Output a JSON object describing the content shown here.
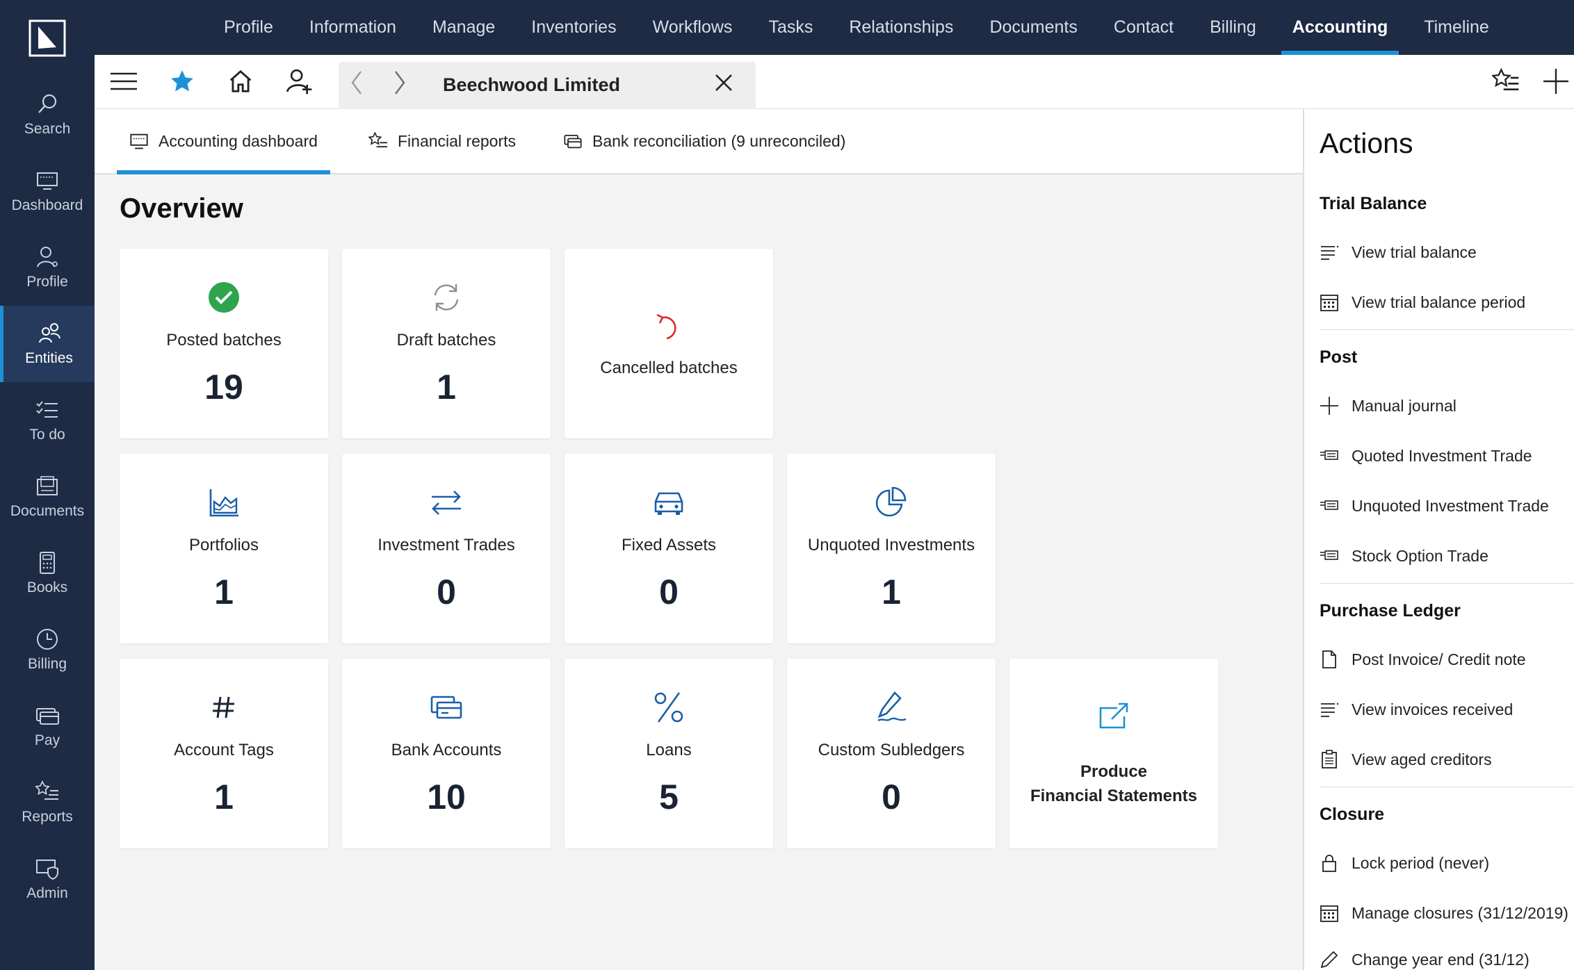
{
  "rail": {
    "items": [
      {
        "label": "Search",
        "icon": "search-icon"
      },
      {
        "label": "Dashboard",
        "icon": "dashboard-icon"
      },
      {
        "label": "Profile",
        "icon": "profile-icon"
      },
      {
        "label": "Entities",
        "icon": "entities-icon",
        "active": true
      },
      {
        "label": "To do",
        "icon": "todo-icon"
      },
      {
        "label": "Documents",
        "icon": "documents-icon"
      },
      {
        "label": "Books",
        "icon": "calculator-icon"
      },
      {
        "label": "Billing",
        "icon": "clock-icon"
      },
      {
        "label": "Pay",
        "icon": "payment-icon"
      },
      {
        "label": "Reports",
        "icon": "reports-icon"
      },
      {
        "label": "Admin",
        "icon": "admin-icon"
      }
    ]
  },
  "topnav": {
    "items": [
      "Profile",
      "Information",
      "Manage",
      "Inventories",
      "Workflows",
      "Tasks",
      "Relationships",
      "Documents",
      "Contact",
      "Billing",
      "Accounting",
      "Timeline"
    ],
    "active": "Accounting"
  },
  "record": {
    "title": "Beechwood Limited"
  },
  "subtabs": [
    {
      "label": "Accounting dashboard",
      "icon": "monitor-icon",
      "active": true
    },
    {
      "label": "Financial reports",
      "icon": "star-list-icon"
    },
    {
      "label": "Bank reconciliation (9 unreconciled)",
      "icon": "bank-card-icon"
    }
  ],
  "overview": {
    "title": "Overview"
  },
  "cards": [
    {
      "label": "Posted batches",
      "value": "19",
      "icon": "check-circle-icon"
    },
    {
      "label": "Draft batches",
      "value": "1",
      "icon": "refresh-icon"
    },
    {
      "label": "Cancelled batches",
      "value": "",
      "icon": "undo-icon"
    },
    {
      "label": "Portfolios",
      "value": "1",
      "icon": "area-chart-icon"
    },
    {
      "label": "Investment Trades",
      "value": "0",
      "icon": "transfer-arrows-icon"
    },
    {
      "label": "Fixed Assets",
      "value": "0",
      "icon": "car-icon"
    },
    {
      "label": "Unquoted Investments",
      "value": "1",
      "icon": "pie-chart-icon"
    },
    {
      "label": "Account Tags",
      "value": "1",
      "icon": "hash-icon"
    },
    {
      "label": "Bank Accounts",
      "value": "10",
      "icon": "bank-card-icon"
    },
    {
      "label": "Loans",
      "value": "5",
      "icon": "percent-icon"
    },
    {
      "label": "Custom Subledgers",
      "value": "0",
      "icon": "pen-signature-icon"
    },
    {
      "label": "Produce Financial Statements",
      "label_line1": "Produce",
      "label_line2": "Financial Statements",
      "icon": "export-icon"
    }
  ],
  "actions": {
    "title": "Actions",
    "sections": [
      {
        "title": "Trial Balance",
        "items": [
          {
            "label": "View trial balance",
            "icon": "list-icon"
          },
          {
            "label": "View trial balance period",
            "icon": "calendar-icon"
          }
        ]
      },
      {
        "title": "Post",
        "items": [
          {
            "label": "Manual journal",
            "icon": "plus-icon"
          },
          {
            "label": "Quoted Investment Trade",
            "icon": "trade-icon"
          },
          {
            "label": "Unquoted Investment Trade",
            "icon": "trade-icon"
          },
          {
            "label": "Stock Option Trade",
            "icon": "trade-icon"
          }
        ]
      },
      {
        "title": "Purchase Ledger",
        "items": [
          {
            "label": "Post Invoice/ Credit note",
            "icon": "document-icon"
          },
          {
            "label": "View invoices received",
            "icon": "list-icon"
          },
          {
            "label": "View aged creditors",
            "icon": "clipboard-icon"
          }
        ]
      },
      {
        "title": "Closure",
        "items": [
          {
            "label": "Lock period  (never)",
            "icon": "lock-icon"
          },
          {
            "label": "Manage closures  (31/12/2019)",
            "icon": "calendar-icon"
          },
          {
            "label": "Change year end  (31/12)",
            "icon": "pencil-icon"
          }
        ]
      }
    ]
  },
  "colors": {
    "navy": "#1d2b44",
    "accent": "#1e90d8",
    "icon_blue": "#1a5ea8",
    "success": "#2ea44f",
    "danger": "#d92b2b"
  }
}
